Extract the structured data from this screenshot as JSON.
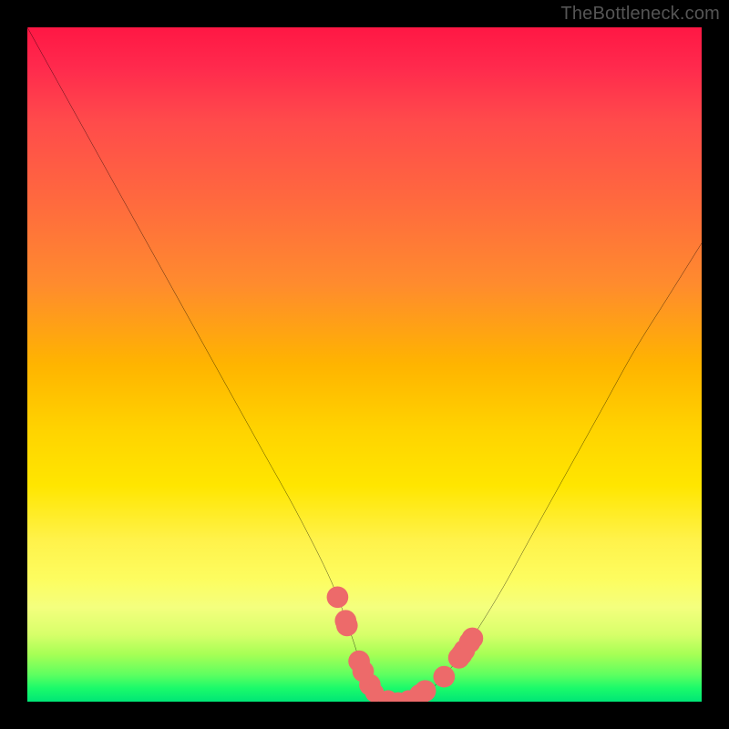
{
  "watermark": {
    "text": "TheBottleneck.com"
  },
  "chart_data": {
    "type": "line",
    "title": "",
    "xlabel": "",
    "ylabel": "",
    "xlim": [
      0,
      100
    ],
    "ylim": [
      0,
      100
    ],
    "series": [
      {
        "name": "curve",
        "x": [
          0,
          5,
          10,
          15,
          20,
          25,
          30,
          35,
          40,
          45,
          48,
          50,
          52,
          55,
          58,
          60,
          62,
          65,
          70,
          75,
          80,
          85,
          90,
          95,
          100
        ],
        "values": [
          100,
          91,
          82,
          73,
          64,
          55,
          46,
          37,
          28,
          18,
          10,
          4,
          0.5,
          0,
          0.5,
          2,
          4,
          8,
          16,
          25,
          34,
          43,
          52,
          60,
          68
        ]
      }
    ],
    "markers": [
      {
        "x": 46.0,
        "y": 15.5,
        "r": 1.6
      },
      {
        "x": 47.2,
        "y": 12.0,
        "r": 1.6
      },
      {
        "x": 47.4,
        "y": 11.3,
        "r": 1.6
      },
      {
        "x": 49.2,
        "y": 6.0,
        "r": 1.6
      },
      {
        "x": 49.8,
        "y": 4.5,
        "r": 1.6
      },
      {
        "x": 50.8,
        "y": 2.5,
        "r": 1.6
      },
      {
        "x": 51.5,
        "y": 1.3,
        "r": 1.4
      },
      {
        "x": 53.5,
        "y": 0.3,
        "r": 1.4
      },
      {
        "x": 55.0,
        "y": 0.0,
        "r": 1.4
      },
      {
        "x": 56.5,
        "y": 0.3,
        "r": 1.4
      },
      {
        "x": 58.2,
        "y": 1.0,
        "r": 1.6
      },
      {
        "x": 59.0,
        "y": 1.6,
        "r": 1.6
      },
      {
        "x": 61.8,
        "y": 3.7,
        "r": 1.6
      },
      {
        "x": 64.0,
        "y": 6.5,
        "r": 1.6
      },
      {
        "x": 64.4,
        "y": 7.0,
        "r": 1.6
      },
      {
        "x": 64.8,
        "y": 7.6,
        "r": 1.6
      },
      {
        "x": 65.6,
        "y": 8.8,
        "r": 1.6
      },
      {
        "x": 66.0,
        "y": 9.4,
        "r": 1.6
      }
    ],
    "marker_color": "#ed6a6a",
    "curve_color": "#000000"
  }
}
